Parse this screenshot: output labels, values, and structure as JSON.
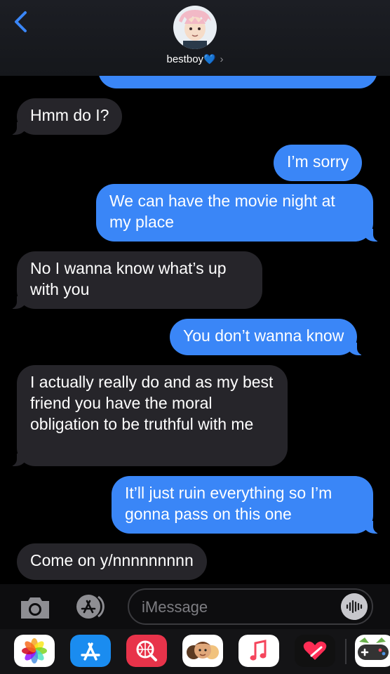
{
  "header": {
    "contact_name": "bestboy",
    "heart": "💙",
    "chevron": "›"
  },
  "messages": [
    {
      "dir": "in",
      "text": "Hmm do I?"
    },
    {
      "dir": "out",
      "text": "I’m sorry"
    },
    {
      "dir": "out",
      "text": "We can have the movie night at my place"
    },
    {
      "dir": "in",
      "text": "No I wanna know what’s up with you"
    },
    {
      "dir": "out",
      "text": "You don’t wanna know"
    },
    {
      "dir": "in",
      "text": "I actually really do and as my best friend you have the moral obligation to be truthful with me"
    },
    {
      "dir": "out",
      "text": "It’ll just ruin everything so I’m gonna pass on this one"
    },
    {
      "dir": "in",
      "text": "Come on y/nnnnnnnnn"
    }
  ],
  "input": {
    "placeholder": "iMessage"
  },
  "apps": [
    "photos-icon",
    "app-store-icon",
    "web-search-icon",
    "memoji-icon",
    "music-icon",
    "digital-touch-icon",
    "game-icon"
  ],
  "colors": {
    "outgoing": "#3a86f7",
    "incoming": "#26252a",
    "accent": "#2f7bf6"
  }
}
